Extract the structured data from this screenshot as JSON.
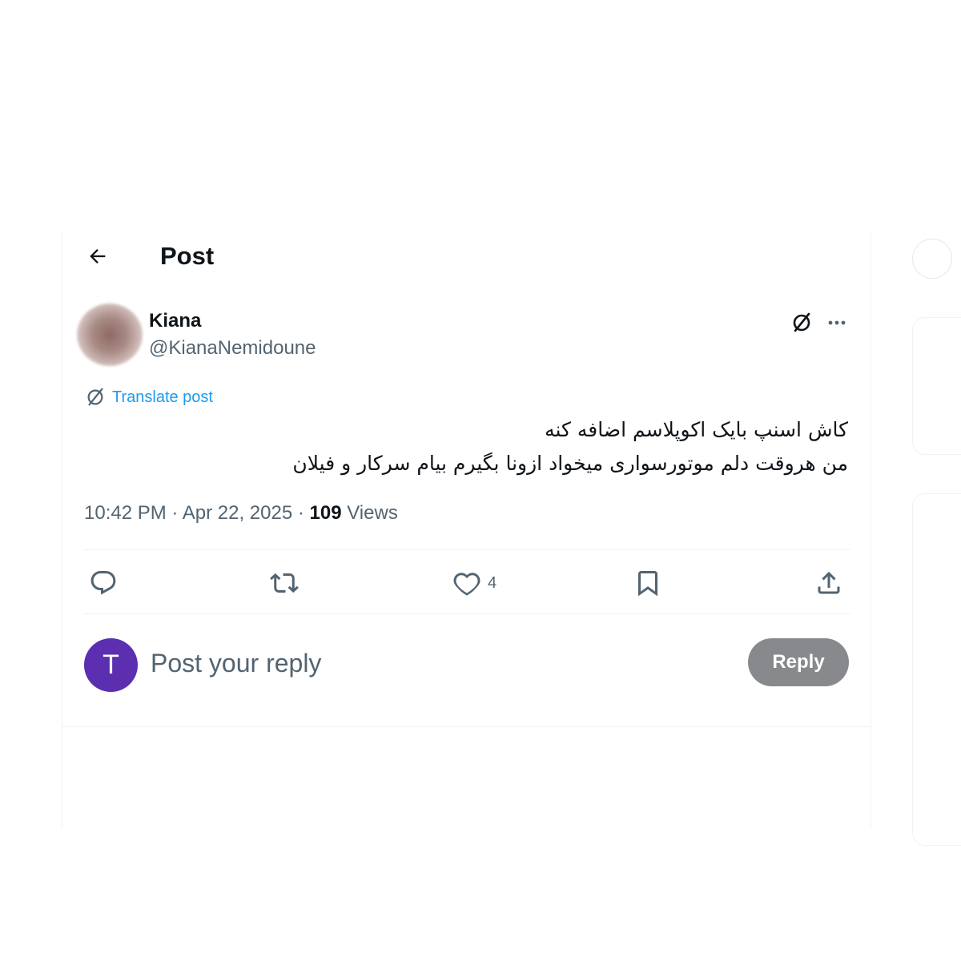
{
  "header": {
    "title": "Post"
  },
  "author": {
    "display_name": "Kiana",
    "handle": "@KianaNemidoune"
  },
  "post": {
    "translate_label": "Translate post",
    "text_lines": [
      "کاش اسنپ بایک اکوپلاسم اضافه کنه",
      "من هروقت دلم موتورسواری میخواد ازونا بگیرم بیام سرکار و فیلان"
    ],
    "time": "10:42 PM",
    "date": "Apr 22, 2025",
    "separator": " · ",
    "views_count": "109",
    "views_label": "Views"
  },
  "actions": {
    "reply_icon": "comment-icon",
    "repost_icon": "repost-icon",
    "like_icon": "heart-icon",
    "like_count": "4",
    "bookmark_icon": "bookmark-icon",
    "share_icon": "share-icon"
  },
  "reply_box": {
    "avatar_letter": "T",
    "placeholder": "Post your reply",
    "button_label": "Reply"
  },
  "colors": {
    "accent": "#1d9bf0",
    "secondary_text": "#536471",
    "reply_avatar": "#5b2fb0",
    "reply_button": "#87898c"
  }
}
